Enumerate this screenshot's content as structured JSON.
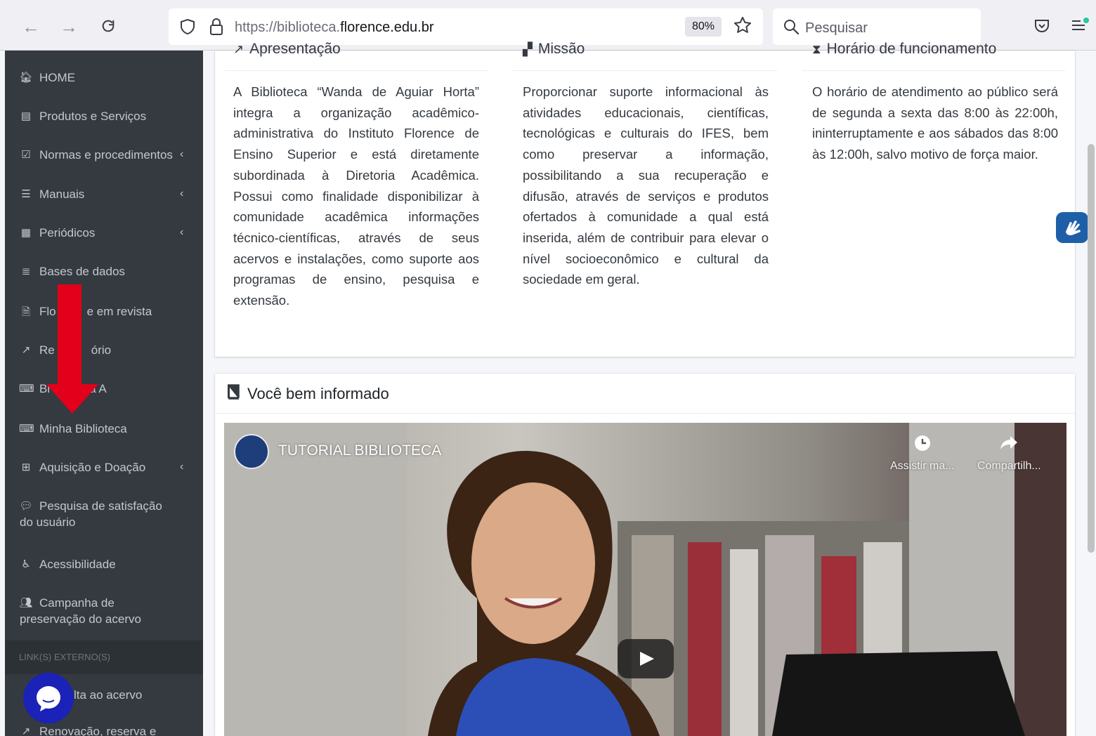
{
  "browser": {
    "url_prefix": "https://biblioteca.",
    "url_domain": "florence.edu.br",
    "zoom": "80%",
    "search_placeholder": "Pesquisar"
  },
  "sidebar": {
    "items": [
      {
        "label": "HOME",
        "icon": "home-icon"
      },
      {
        "label": "Produtos e Serviços",
        "icon": "list-alt-icon"
      },
      {
        "label": "Normas e procedimentos",
        "icon": "check-square-icon"
      },
      {
        "label": "Manuais",
        "icon": "list-icon"
      },
      {
        "label": "Periódicos",
        "icon": "newspaper-icon"
      },
      {
        "label": "Bases de dados",
        "icon": "database-icon"
      },
      {
        "label": "Flo",
        "label_after": "e em revista",
        "icon": "file-icon"
      },
      {
        "label": "Re",
        "label_after": "ório",
        "icon": "external-link-icon"
      },
      {
        "label": "Bi",
        "label_after": "a A",
        "icon": "keyboard-icon"
      },
      {
        "label": "Minha Biblioteca",
        "icon": "keyboard-icon"
      },
      {
        "label": "Aquisição e Doação",
        "icon": "plus-square-icon"
      },
      {
        "label": "Pesquisa de satisfação",
        "label_line2": "do usuário",
        "icon": "comments-icon"
      },
      {
        "label": "Acessibilidade",
        "icon": "wheelchair-icon"
      },
      {
        "label": "Campanha de",
        "label_line2": "preservação do acervo",
        "icon": "users-icon"
      }
    ],
    "section_header": "LINK(S) EXTERNO(S)",
    "external_items": [
      {
        "label": "lta ao acervo",
        "icon": "external-link-icon"
      },
      {
        "label": "Renovação, reserva e",
        "icon": "external-link-icon"
      }
    ]
  },
  "info": {
    "apresentacao": {
      "title": "Apresentação",
      "text": "A Biblioteca “Wanda de Aguiar Horta” integra a organização acadêmico-administrativa do Instituto Florence de Ensino Superior e está diretamente subordinada à Diretoria Acadêmica. Possui como finalidade disponibilizar à comunidade acadêmica informações técnico-científicas, através de seus acervos e instalações, como suporte aos programas de ensino, pesquisa e extensão."
    },
    "missao": {
      "title": "Missão",
      "text": "Proporcionar suporte informacional às atividades educacionais, científicas, tecnológicas e culturais do IFES, bem como preservar a informação, possibilitando a sua recuperação e difusão, através de serviços e produtos ofertados à comunidade a qual está inserida, além de contribuir para elevar o nível socioeconômico e cultural da sociedade em geral."
    },
    "horario": {
      "title": "Horário de funcionamento",
      "text": "O horário de atendimento ao público será de segunda a sexta das 8:00 às 22:00h, ininterruptamente e aos sábados das 8:00 às 12:00h, salvo motivo de força maior."
    }
  },
  "video_card": {
    "title": "Você bem informado",
    "video_title": "TUTORIAL BIBLIOTECA",
    "watch_later": "Assistir ma...",
    "share": "Compartilh..."
  }
}
